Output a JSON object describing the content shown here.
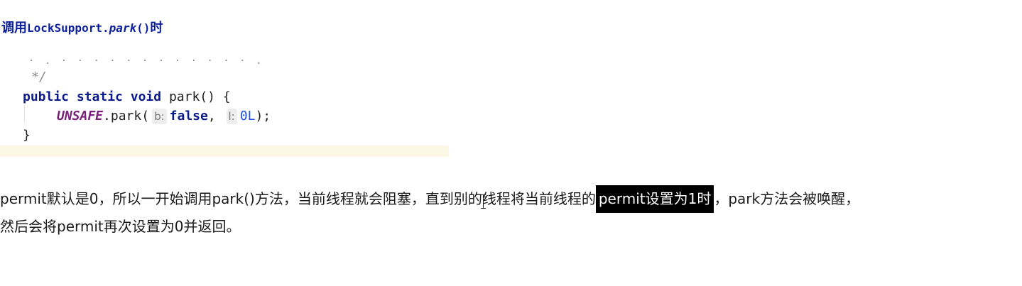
{
  "heading": {
    "prefix": "调用",
    "class_name": "LockSupport.",
    "method_name": "park",
    "parens": "()",
    "suffix": "时"
  },
  "code": {
    "comment_end": "*/",
    "kw_public": "public",
    "kw_static": "static",
    "kw_void": "void",
    "signature_rest": " park() {",
    "unsafe": "UNSAFE",
    "call": ".park(",
    "hint_b": "b:",
    "kw_false": "false",
    "comma": ", ",
    "hint_l": "l:",
    "num_0L": "0L",
    "call_end": ");",
    "close_brace": "}"
  },
  "paragraph": {
    "line1_before": "permit默认是0，所以一开始调用park()方法，当前线程就会阻塞，直到别的线程将当前线程的",
    "line1_highlight": "permit设置为1时",
    "line1_after": "，park方法会被唤醒，",
    "line2": "然后会将permit再次设置为0并返回。"
  },
  "colors": {
    "heading": "#0b1f9e",
    "keyword": "#0a1a8a",
    "unsafe": "#7a1f7a",
    "number": "#1750eb",
    "highlight_bg": "#000000",
    "highlight_fg": "#ffffff",
    "current_line": "#fdf8e6"
  }
}
